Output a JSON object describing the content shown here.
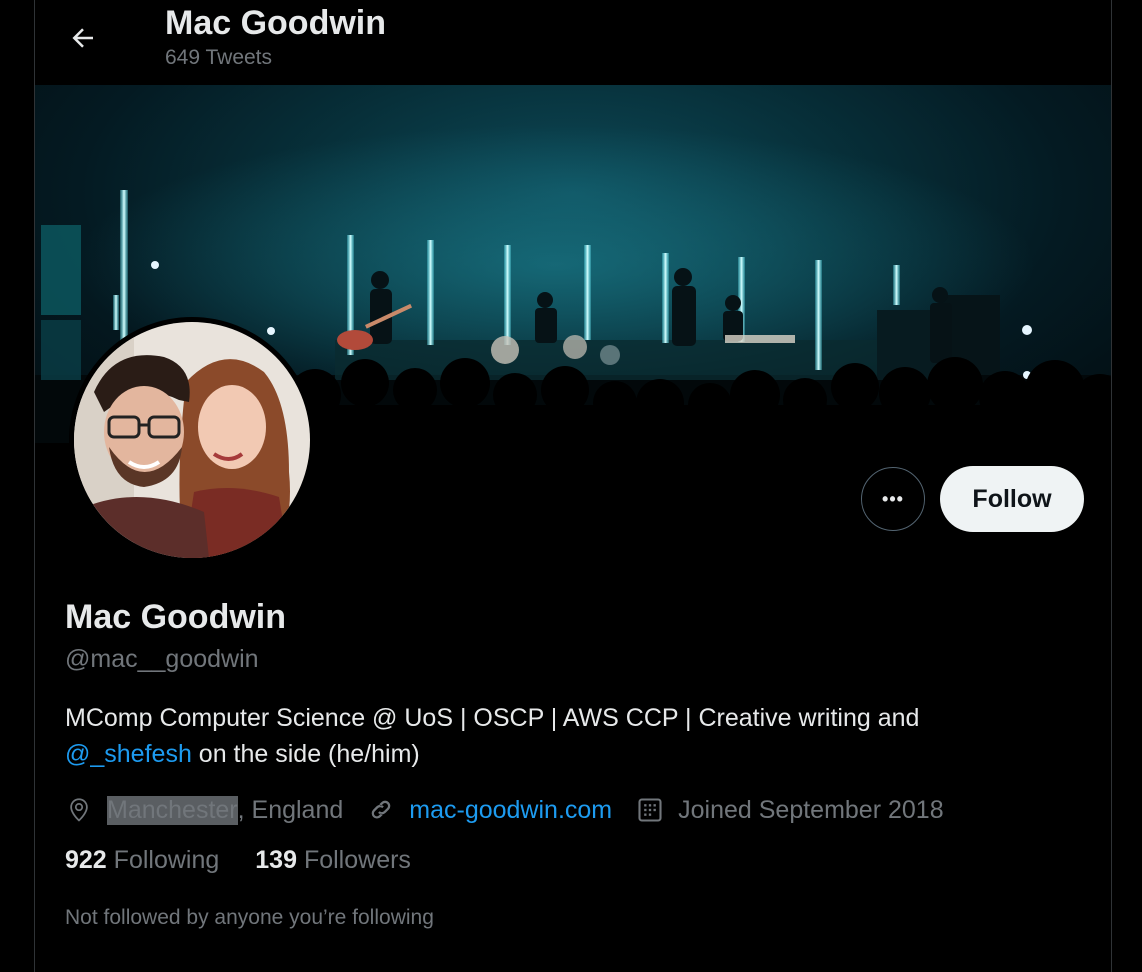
{
  "header": {
    "title": "Mac Goodwin",
    "tweets_count": "649 Tweets"
  },
  "profile": {
    "name": "Mac Goodwin",
    "handle": "@mac__goodwin",
    "bio_line1": "MComp Computer Science @ UoS | OSCP | AWS CCP | Creative writing and",
    "bio_mention": "@_shefesh",
    "bio_line2_rest": " on the side (he/him)",
    "location_highlight": "Manchester",
    "location_rest": ", England",
    "website": "mac-goodwin.com",
    "joined": "Joined September 2018",
    "following_count": "922",
    "following_label": "Following",
    "followers_count": "139",
    "followers_label": "Followers",
    "not_followed": "Not followed by anyone you’re following"
  },
  "actions": {
    "more_label": "•••",
    "follow_label": "Follow"
  },
  "colors": {
    "background": "#000000",
    "link": "#1d9bf0",
    "muted": "#71767b",
    "follow_button": "#eff3f4"
  },
  "icons": {
    "back": "arrow-left-icon",
    "location": "location-pin-icon",
    "website": "link-icon",
    "joined": "calendar-icon"
  }
}
